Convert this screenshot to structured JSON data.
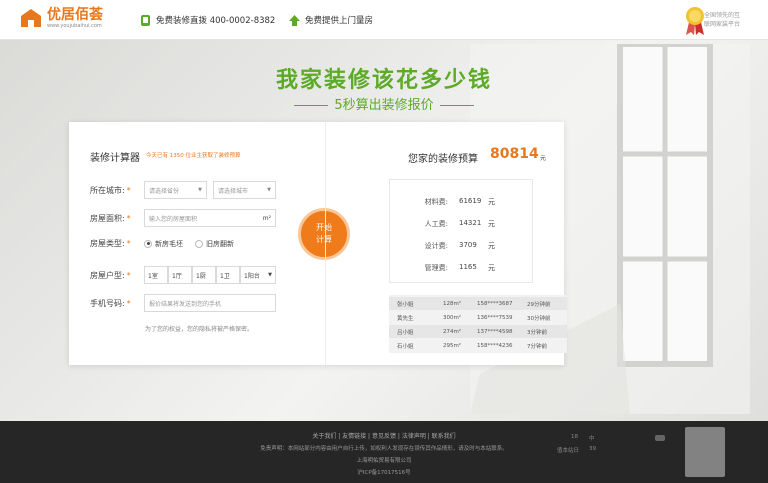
{
  "header": {
    "logo_name": "优居佰荟",
    "logo_url": "www.youjubaihui.com",
    "hotline": "免费装修直拨 400-0002-8382",
    "measure": "免费提供上门量房",
    "badge_text_1": "全国领先的互",
    "badge_text_2": "联网家装平台"
  },
  "hero": {
    "title": "我家装修该花多少钱",
    "subtitle": "5秒算出装修报价"
  },
  "calculator": {
    "title": "装修计算器",
    "note": "今天已有 1350 位业主获取了装修预算",
    "city_label": "所在城市:",
    "province_placeholder": "请选择省份",
    "city_placeholder": "请选择城市",
    "area_label": "房屋面积:",
    "area_placeholder": "输入您的房屋面积",
    "area_unit": "m²",
    "type_label": "房屋类型:",
    "type_new": "新房毛坯",
    "type_old": "旧房翻新",
    "layout_label": "房屋户型:",
    "layout": {
      "room": "1室",
      "hall": "1厅",
      "kitchen": "1厨",
      "bath": "1卫",
      "balcony": "1阳台"
    },
    "phone_label": "手机号码:",
    "phone_placeholder": "报价结果将发送到您的手机",
    "privacy": "为了您的权益，您的隐私将被严格保密。",
    "start_1": "开始",
    "start_2": "计算"
  },
  "budget": {
    "label": "您家的装修预算",
    "value": "80814",
    "unit": "元",
    "items": [
      {
        "name": "材料费:",
        "value": "61619",
        "unit": "元"
      },
      {
        "name": "人工费:",
        "value": "14321",
        "unit": "元"
      },
      {
        "name": "设计费:",
        "value": "3709",
        "unit": "元"
      },
      {
        "name": "管理费:",
        "value": "1165",
        "unit": "元"
      }
    ]
  },
  "records": [
    {
      "name": "张小姐",
      "area": "128m²",
      "phone": "158****3687",
      "time": "29分钟前"
    },
    {
      "name": "黄先生",
      "area": "300m²",
      "phone": "136****7539",
      "time": "30分钟前"
    },
    {
      "name": "吕小姐",
      "area": "274m²",
      "phone": "137****4598",
      "time": "3分钟前"
    },
    {
      "name": "石小姐",
      "area": "295m²",
      "phone": "158****4236",
      "time": "7分钟前"
    }
  ],
  "footer": {
    "links": "关于我们 | 友情链接 | 意见反馈 | 法律声明 | 联系我们",
    "disclaimer": "免责声明：本网站部分内容由用户自行上传，如权利人发现存在误传其作品情形，请及时与本站联系。",
    "company": "上海明佑贸易有限公司",
    "icp": "沪ICP备17017516号",
    "side_1": "18",
    "side_2": "中",
    "side_3": "值本站日",
    "side_4": "39"
  },
  "colors": {
    "brand_orange": "#ef7b1a",
    "brand_green": "#5cab25",
    "footer_bg": "#262626"
  }
}
